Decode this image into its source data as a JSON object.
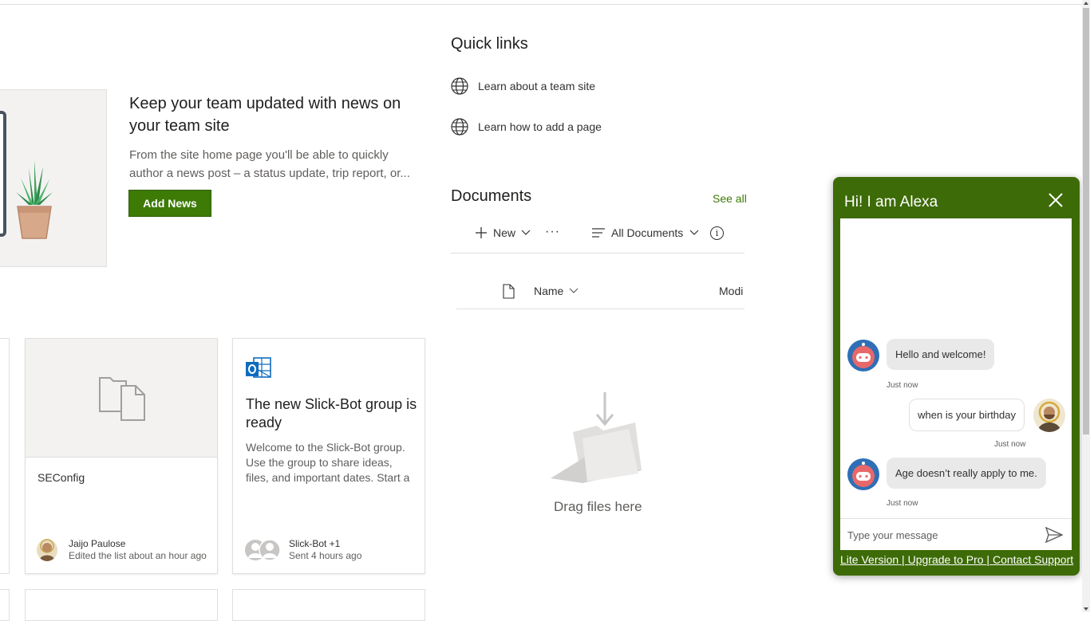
{
  "news": {
    "title": "Keep your team updated with news on your team site",
    "description": "From the site home page you'll be able to quickly author a news post – a status update, trip report, or...",
    "add_button": "Add News"
  },
  "quick_links": {
    "title": "Quick links",
    "items": [
      {
        "label": "Learn about a team site",
        "icon": "globe-icon"
      },
      {
        "label": "Learn how to add a page",
        "icon": "globe-icon"
      }
    ]
  },
  "documents": {
    "title": "Documents",
    "see_all": "See all",
    "toolbar": {
      "new_label": "New",
      "more": "···",
      "view_label": "All Documents",
      "info": "i"
    },
    "columns": {
      "name": "Name",
      "modified": "Modi"
    },
    "empty_text": "Drag files here"
  },
  "cards": [
    {
      "name": "SEConfig",
      "author": "Jaijo Paulose",
      "activity": "Edited the list about an hour ago"
    },
    {
      "title": "The new Slick-Bot group is ready",
      "description": "Welcome to the Slick-Bot group. Use the group to share ideas, files, and important dates. Start a",
      "author": "Slick-Bot +1",
      "activity": "Sent 4 hours ago"
    }
  ],
  "chat": {
    "title": "Hi! I am Alexa",
    "messages": [
      {
        "from": "bot",
        "text": "Hello and welcome!",
        "time": "Just now"
      },
      {
        "from": "user",
        "text": "when is your birthday",
        "time": "Just now"
      },
      {
        "from": "bot",
        "text": "Age doesn’t really apply to me.",
        "time": "Just now"
      }
    ],
    "input_placeholder": "Type your message",
    "footer": {
      "lite": "Lite Version",
      "upgrade": "Upgrade to Pro",
      "support": "Contact Support",
      "separator": " | "
    }
  },
  "colors": {
    "accent": "#3d7a06",
    "chat_frame": "#3d6b07",
    "bubble_bot": "#e9e9ea"
  }
}
